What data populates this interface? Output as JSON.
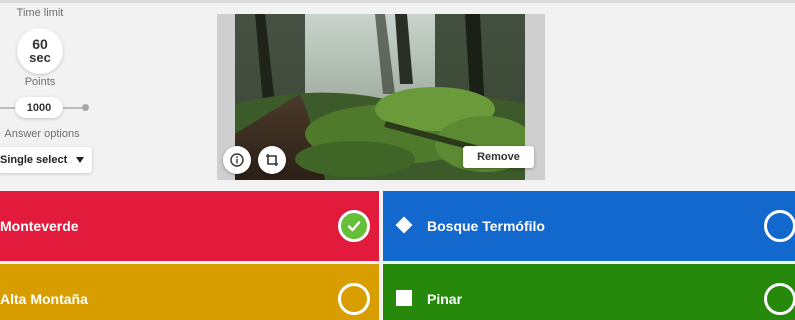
{
  "settings": {
    "time_limit_label": "Time limit",
    "time_value": "60",
    "time_unit": "sec",
    "points_label": "Points",
    "points_value": "1000",
    "answer_options_label": "Answer options",
    "answer_type": "Single select"
  },
  "media": {
    "remove_label": "Remove",
    "info_icon": "info-icon",
    "crop_icon": "crop-icon"
  },
  "answers": [
    {
      "text": "Monteverde",
      "color": "#e21b3c",
      "shape": "triangle",
      "correct": true
    },
    {
      "text": "Bosque Termófilo",
      "color": "#1368ce",
      "shape": "diamond",
      "correct": false
    },
    {
      "text": "Alta Montaña",
      "color": "#d89e00",
      "shape": "circle",
      "correct": false
    },
    {
      "text": "Pinar",
      "color": "#26890c",
      "shape": "square",
      "correct": false
    }
  ],
  "colors": {
    "correct_check": "#66bf39",
    "background": "#f2f2f2"
  }
}
